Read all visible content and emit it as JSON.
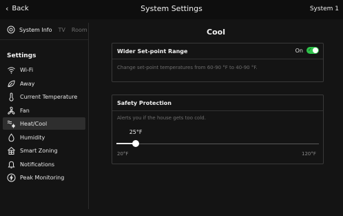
{
  "header": {
    "back_label": "Back",
    "title": "System Settings",
    "system_name": "System 1"
  },
  "sidebar": {
    "system_info": {
      "label": "System Info",
      "extra": [
        "TV",
        "Room"
      ]
    },
    "settings_heading": "Settings",
    "items": [
      {
        "label": "Wi-Fi",
        "icon": "wifi-icon"
      },
      {
        "label": "Away",
        "icon": "away-leaf-icon"
      },
      {
        "label": "Current Temperature",
        "icon": "thermometer-icon"
      },
      {
        "label": "Fan",
        "icon": "fan-icon"
      },
      {
        "label": "Heat/Cool",
        "icon": "heat-cool-icon",
        "active": true
      },
      {
        "label": "Humidity",
        "icon": "droplet-icon"
      },
      {
        "label": "Smart Zoning",
        "icon": "zoning-house-icon"
      },
      {
        "label": "Notifications",
        "icon": "bell-icon"
      },
      {
        "label": "Peak Monitoring",
        "icon": "lightning-circle-icon"
      }
    ]
  },
  "main": {
    "title": "Cool",
    "wider_range": {
      "title": "Wider Set-point Range",
      "toggle_label": "On",
      "enabled": true,
      "description": "Change set-point temperatures from 60-90 °F to 40-90 °F."
    },
    "safety": {
      "title": "Safety Protection",
      "description": "Alerts you if the house gets too cold.",
      "value": 25,
      "value_label": "25°F",
      "min": 20,
      "max": 120,
      "min_label": "20°F",
      "max_label": "120°F"
    }
  },
  "colors": {
    "toggle_on": "#2ec24a",
    "background": "#141414"
  }
}
